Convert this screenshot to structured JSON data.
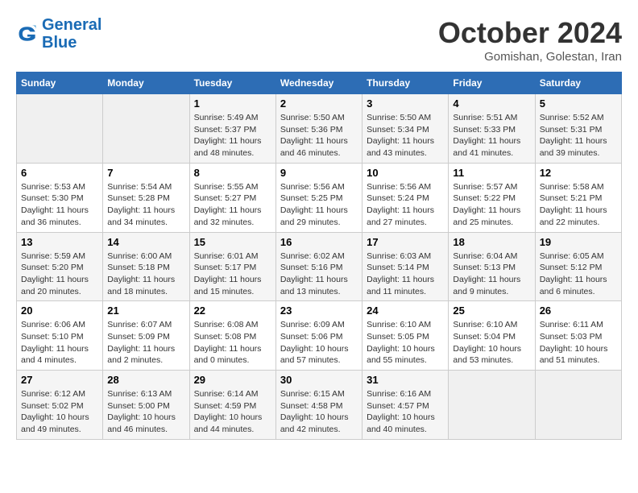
{
  "header": {
    "logo_line1": "General",
    "logo_line2": "Blue",
    "month": "October 2024",
    "location": "Gomishan, Golestan, Iran"
  },
  "weekdays": [
    "Sunday",
    "Monday",
    "Tuesday",
    "Wednesday",
    "Thursday",
    "Friday",
    "Saturday"
  ],
  "weeks": [
    [
      {
        "day": "",
        "sunrise": "",
        "sunset": "",
        "daylight": ""
      },
      {
        "day": "",
        "sunrise": "",
        "sunset": "",
        "daylight": ""
      },
      {
        "day": "1",
        "sunrise": "Sunrise: 5:49 AM",
        "sunset": "Sunset: 5:37 PM",
        "daylight": "Daylight: 11 hours and 48 minutes."
      },
      {
        "day": "2",
        "sunrise": "Sunrise: 5:50 AM",
        "sunset": "Sunset: 5:36 PM",
        "daylight": "Daylight: 11 hours and 46 minutes."
      },
      {
        "day": "3",
        "sunrise": "Sunrise: 5:50 AM",
        "sunset": "Sunset: 5:34 PM",
        "daylight": "Daylight: 11 hours and 43 minutes."
      },
      {
        "day": "4",
        "sunrise": "Sunrise: 5:51 AM",
        "sunset": "Sunset: 5:33 PM",
        "daylight": "Daylight: 11 hours and 41 minutes."
      },
      {
        "day": "5",
        "sunrise": "Sunrise: 5:52 AM",
        "sunset": "Sunset: 5:31 PM",
        "daylight": "Daylight: 11 hours and 39 minutes."
      }
    ],
    [
      {
        "day": "6",
        "sunrise": "Sunrise: 5:53 AM",
        "sunset": "Sunset: 5:30 PM",
        "daylight": "Daylight: 11 hours and 36 minutes."
      },
      {
        "day": "7",
        "sunrise": "Sunrise: 5:54 AM",
        "sunset": "Sunset: 5:28 PM",
        "daylight": "Daylight: 11 hours and 34 minutes."
      },
      {
        "day": "8",
        "sunrise": "Sunrise: 5:55 AM",
        "sunset": "Sunset: 5:27 PM",
        "daylight": "Daylight: 11 hours and 32 minutes."
      },
      {
        "day": "9",
        "sunrise": "Sunrise: 5:56 AM",
        "sunset": "Sunset: 5:25 PM",
        "daylight": "Daylight: 11 hours and 29 minutes."
      },
      {
        "day": "10",
        "sunrise": "Sunrise: 5:56 AM",
        "sunset": "Sunset: 5:24 PM",
        "daylight": "Daylight: 11 hours and 27 minutes."
      },
      {
        "day": "11",
        "sunrise": "Sunrise: 5:57 AM",
        "sunset": "Sunset: 5:22 PM",
        "daylight": "Daylight: 11 hours and 25 minutes."
      },
      {
        "day": "12",
        "sunrise": "Sunrise: 5:58 AM",
        "sunset": "Sunset: 5:21 PM",
        "daylight": "Daylight: 11 hours and 22 minutes."
      }
    ],
    [
      {
        "day": "13",
        "sunrise": "Sunrise: 5:59 AM",
        "sunset": "Sunset: 5:20 PM",
        "daylight": "Daylight: 11 hours and 20 minutes."
      },
      {
        "day": "14",
        "sunrise": "Sunrise: 6:00 AM",
        "sunset": "Sunset: 5:18 PM",
        "daylight": "Daylight: 11 hours and 18 minutes."
      },
      {
        "day": "15",
        "sunrise": "Sunrise: 6:01 AM",
        "sunset": "Sunset: 5:17 PM",
        "daylight": "Daylight: 11 hours and 15 minutes."
      },
      {
        "day": "16",
        "sunrise": "Sunrise: 6:02 AM",
        "sunset": "Sunset: 5:16 PM",
        "daylight": "Daylight: 11 hours and 13 minutes."
      },
      {
        "day": "17",
        "sunrise": "Sunrise: 6:03 AM",
        "sunset": "Sunset: 5:14 PM",
        "daylight": "Daylight: 11 hours and 11 minutes."
      },
      {
        "day": "18",
        "sunrise": "Sunrise: 6:04 AM",
        "sunset": "Sunset: 5:13 PM",
        "daylight": "Daylight: 11 hours and 9 minutes."
      },
      {
        "day": "19",
        "sunrise": "Sunrise: 6:05 AM",
        "sunset": "Sunset: 5:12 PM",
        "daylight": "Daylight: 11 hours and 6 minutes."
      }
    ],
    [
      {
        "day": "20",
        "sunrise": "Sunrise: 6:06 AM",
        "sunset": "Sunset: 5:10 PM",
        "daylight": "Daylight: 11 hours and 4 minutes."
      },
      {
        "day": "21",
        "sunrise": "Sunrise: 6:07 AM",
        "sunset": "Sunset: 5:09 PM",
        "daylight": "Daylight: 11 hours and 2 minutes."
      },
      {
        "day": "22",
        "sunrise": "Sunrise: 6:08 AM",
        "sunset": "Sunset: 5:08 PM",
        "daylight": "Daylight: 11 hours and 0 minutes."
      },
      {
        "day": "23",
        "sunrise": "Sunrise: 6:09 AM",
        "sunset": "Sunset: 5:06 PM",
        "daylight": "Daylight: 10 hours and 57 minutes."
      },
      {
        "day": "24",
        "sunrise": "Sunrise: 6:10 AM",
        "sunset": "Sunset: 5:05 PM",
        "daylight": "Daylight: 10 hours and 55 minutes."
      },
      {
        "day": "25",
        "sunrise": "Sunrise: 6:10 AM",
        "sunset": "Sunset: 5:04 PM",
        "daylight": "Daylight: 10 hours and 53 minutes."
      },
      {
        "day": "26",
        "sunrise": "Sunrise: 6:11 AM",
        "sunset": "Sunset: 5:03 PM",
        "daylight": "Daylight: 10 hours and 51 minutes."
      }
    ],
    [
      {
        "day": "27",
        "sunrise": "Sunrise: 6:12 AM",
        "sunset": "Sunset: 5:02 PM",
        "daylight": "Daylight: 10 hours and 49 minutes."
      },
      {
        "day": "28",
        "sunrise": "Sunrise: 6:13 AM",
        "sunset": "Sunset: 5:00 PM",
        "daylight": "Daylight: 10 hours and 46 minutes."
      },
      {
        "day": "29",
        "sunrise": "Sunrise: 6:14 AM",
        "sunset": "Sunset: 4:59 PM",
        "daylight": "Daylight: 10 hours and 44 minutes."
      },
      {
        "day": "30",
        "sunrise": "Sunrise: 6:15 AM",
        "sunset": "Sunset: 4:58 PM",
        "daylight": "Daylight: 10 hours and 42 minutes."
      },
      {
        "day": "31",
        "sunrise": "Sunrise: 6:16 AM",
        "sunset": "Sunset: 4:57 PM",
        "daylight": "Daylight: 10 hours and 40 minutes."
      },
      {
        "day": "",
        "sunrise": "",
        "sunset": "",
        "daylight": ""
      },
      {
        "day": "",
        "sunrise": "",
        "sunset": "",
        "daylight": ""
      }
    ]
  ]
}
